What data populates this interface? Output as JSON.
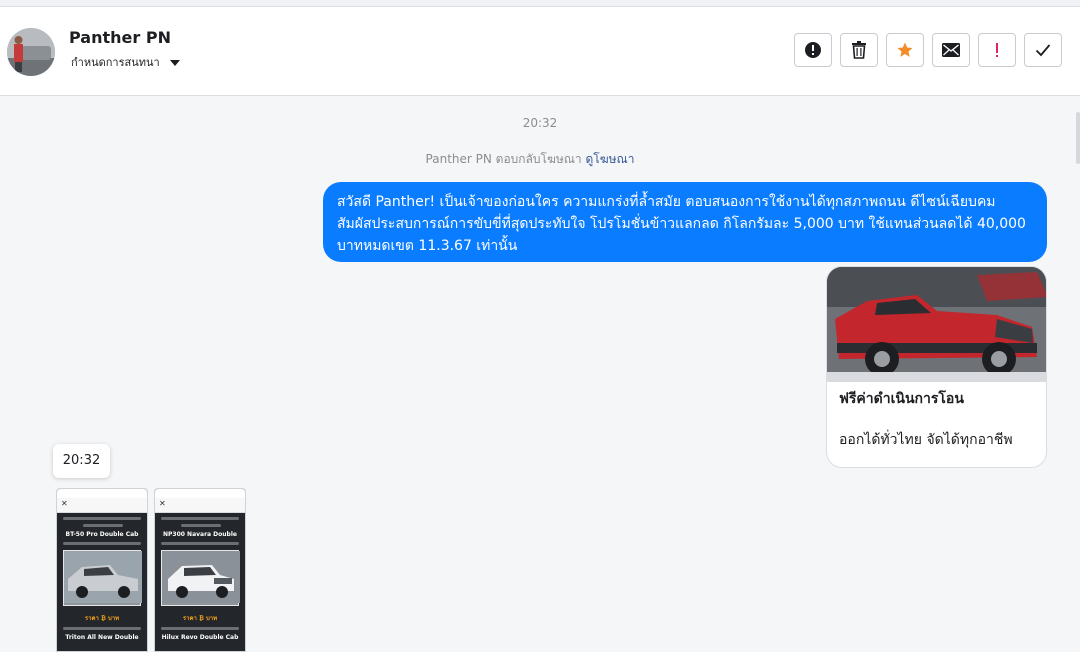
{
  "header": {
    "contact_name": "Panther PN",
    "assign_label": "กำหนดการสนทนา",
    "actions": [
      {
        "icon": "exclamation-circle-icon",
        "label": "!"
      },
      {
        "icon": "trash-icon",
        "label": ""
      },
      {
        "icon": "star-icon",
        "label": ""
      },
      {
        "icon": "envelope-icon",
        "label": ""
      },
      {
        "icon": "spam-exclamation-icon",
        "label": "!"
      },
      {
        "icon": "check-icon",
        "label": ""
      }
    ]
  },
  "chat": {
    "timestamp_top": "20:32",
    "reply_note": "Panther PN ตอบกลับโฆษณา",
    "reply_link": "ดูโฆษณา",
    "message": "สวัสดี Panther! เป็นเจ้าของก่อนใคร ความแกร่งที่ล้ำสมัย ตอบสนองการใช้งานได้ทุกสภาพถนน ดีไซน์เฉียบคม สัมผัสประสบการณ์การขับขี่ที่สุดประทับใจ โปรโมชั่นข้าวแลกลด กิโลกรัมละ 5,000 บาท ใช้แทนส่วนลดได้ 40,000 บาทหมดเขต 11.3.67 เท่านั้น",
    "card": {
      "title": "ฟรีค่าดำเนินการโอน",
      "subtitle": "ออกได้ทั่วไทย จัดได้ทุกอาชีพ"
    },
    "timestamp_tooltip": "20:32"
  },
  "colors": {
    "bubble": "#0a7cff",
    "star": "#f28c28",
    "spam": "#e0245e"
  }
}
